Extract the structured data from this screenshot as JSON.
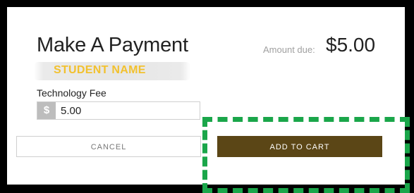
{
  "payment": {
    "title": "Make A Payment",
    "amount_label": "Amount due:",
    "amount_value": "$5.00",
    "student_name": "STUDENT NAME",
    "fee_label": "Technology Fee",
    "currency_symbol": "$",
    "fee_value": "5.00"
  },
  "actions": {
    "cancel_label": "CANCEL",
    "add_to_cart_label": "ADD TO CART"
  },
  "colors": {
    "add_to_cart_bg": "#5b4616",
    "student_name_text": "#f2c12e",
    "highlight_border": "#1aa64a",
    "currency_badge_bg": "#bdbdbd"
  },
  "icons": {
    "currency": "dollar-sign-icon"
  }
}
